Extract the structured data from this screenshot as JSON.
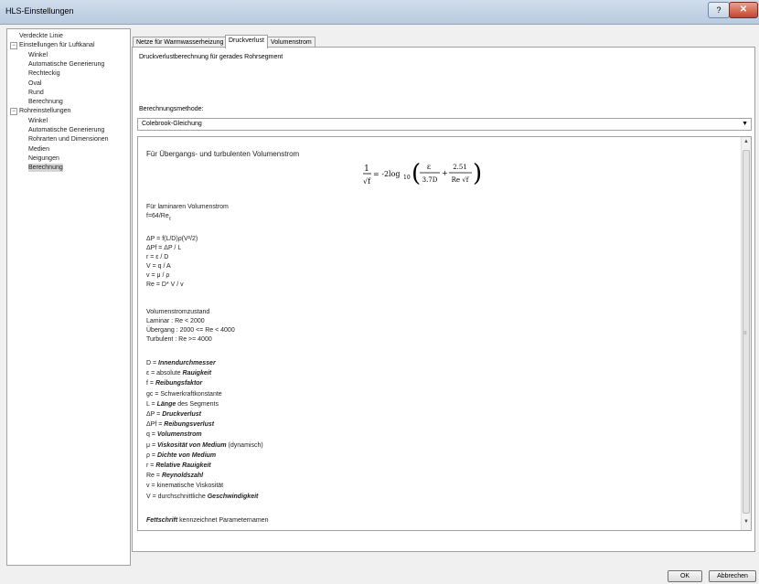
{
  "window": {
    "title": "HLS-Einstellungen",
    "help_label": "?",
    "close_label": "✕"
  },
  "tree": [
    {
      "label": "Verdeckte Linie",
      "level": 0,
      "toggle": ""
    },
    {
      "label": "Einstellungen für Luftkanal",
      "level": 0,
      "toggle": "−"
    },
    {
      "label": "Winkel",
      "level": 1,
      "toggle": ""
    },
    {
      "label": "Automatische Generierung",
      "level": 1,
      "toggle": ""
    },
    {
      "label": "Rechteckig",
      "level": 1,
      "toggle": ""
    },
    {
      "label": "Oval",
      "level": 1,
      "toggle": ""
    },
    {
      "label": "Rund",
      "level": 1,
      "toggle": ""
    },
    {
      "label": "Berechnung",
      "level": 1,
      "toggle": ""
    },
    {
      "label": "Rohreinstellungen",
      "level": 0,
      "toggle": "−"
    },
    {
      "label": "Winkel",
      "level": 1,
      "toggle": ""
    },
    {
      "label": "Automatische Generierung",
      "level": 1,
      "toggle": ""
    },
    {
      "label": "Rohrarten und Dimensionen",
      "level": 1,
      "toggle": ""
    },
    {
      "label": "Medien",
      "level": 1,
      "toggle": ""
    },
    {
      "label": "Neigungen",
      "level": 1,
      "toggle": ""
    },
    {
      "label": "Berechnung",
      "level": 1,
      "toggle": "",
      "selected": true
    }
  ],
  "tabs": [
    "Netze für Warmwasserheizung",
    "Druckverlust",
    "Volumenstrom"
  ],
  "active_tab": 1,
  "panel": {
    "description": "Druckverlustberechnung für gerades Rohrsegment",
    "method_label": "Berechnungsmethode:",
    "method_value": "Colebrook-Gleichung"
  },
  "content": {
    "heading_turbulent": "Für Übergangs- und turbulenten Volumenstrom",
    "formula": {
      "lhs_num": "1",
      "lhs_den": "√f",
      "eq": "= -2log",
      "sub": "10",
      "frac1_num": "ε",
      "frac1_den": "3.7D",
      "plus": "+",
      "frac2_num": "2.51",
      "frac2_den": "Re √f"
    },
    "laminar_heading": "Für laminaren Volumenstrom",
    "laminar_formula": "f=64/Re",
    "laminar_sub": "ε",
    "equations": [
      "ΔP = f(L/D)ρ(V²/2)",
      "ΔPf = ΔP / L",
      "r = ε / D",
      "V = q / A",
      "v = μ / ρ",
      "Re = D* V / v"
    ],
    "state_heading": "Volumenstromzustand",
    "states": [
      "Laminar : Re < 2000",
      "Übergang : 2000 <= Re < 4000",
      "Turbulent : Re >= 4000"
    ],
    "definitions": [
      {
        "sym": "D = ",
        "name": "Innendurchmesser",
        "rest": ""
      },
      {
        "sym": "ε = absolute ",
        "name": "Rauigkeit",
        "rest": ""
      },
      {
        "sym": "f = ",
        "name": "Reibungsfaktor",
        "rest": ""
      },
      {
        "sym": "gc = Schwerkraftkonstante",
        "name": "",
        "rest": ""
      },
      {
        "sym": "L = ",
        "name": "Länge",
        "rest": " des Segments"
      },
      {
        "sym": "ΔP = ",
        "name": "Druckverlust",
        "rest": ""
      },
      {
        "sym": "ΔPf = ",
        "name": "Reibungsverlust",
        "rest": ""
      },
      {
        "sym": "q = ",
        "name": "Volumenstrom",
        "rest": ""
      },
      {
        "sym": "μ = ",
        "name": "Viskosität von Medium",
        "rest": " (dynamisch)"
      },
      {
        "sym": "ρ = ",
        "name": "Dichte von Medium",
        "rest": ""
      },
      {
        "sym": "r = ",
        "name": "Relative Rauigkeit",
        "rest": ""
      },
      {
        "sym": "Re = ",
        "name": "Reynoldszahl",
        "rest": ""
      },
      {
        "sym": "v = kinematische Viskosität",
        "name": "",
        "rest": ""
      },
      {
        "sym": "V = durchschnittliche ",
        "name": "Geschwindigkeit",
        "rest": ""
      }
    ],
    "footer_bold": "Fettschrift",
    "footer_rest": " kennzeichnet Parameternamen"
  },
  "buttons": {
    "ok": "OK",
    "cancel": "Abbrechen"
  }
}
